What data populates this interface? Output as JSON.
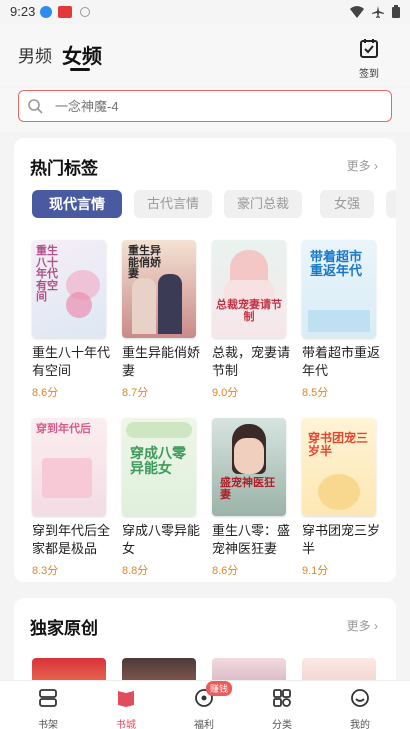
{
  "status": {
    "time": "9:23"
  },
  "header": {
    "tabs": [
      {
        "label": "男频"
      },
      {
        "label": "女频"
      }
    ],
    "signin_label": "签到"
  },
  "search": {
    "placeholder": "一念神魔-4"
  },
  "hot_tags": {
    "title": "热门标签",
    "more": "更多 ›",
    "chips": [
      {
        "label": "现代言情"
      },
      {
        "label": "古代言情"
      },
      {
        "label": "豪门总裁"
      },
      {
        "label": "女强"
      }
    ],
    "books": [
      {
        "title": "重生八十年代有空间",
        "score": "8.6分",
        "cover_text": "重生八十年代有空间"
      },
      {
        "title": "重生异能俏娇妻",
        "score": "8.7分",
        "cover_text": "重生异能俏娇妻"
      },
      {
        "title": "总裁，宠妻请节制",
        "score": "9.0分",
        "cover_text": "总裁宠妻请节制"
      },
      {
        "title": "带着超市重返年代",
        "score": "8.5分",
        "cover_text": "带着超市重返年代"
      },
      {
        "title": "穿到年代后全家都是极品",
        "score": "8.3分",
        "cover_text": "穿到年代后"
      },
      {
        "title": "穿成八零异能女",
        "score": "8.8分",
        "cover_text": "穿成八零异能女"
      },
      {
        "title": "重生八零：盛宠神医狂妻",
        "score": "8.6分",
        "cover_text": "盛宠神医狂妻"
      },
      {
        "title": "穿书团宠三岁半",
        "score": "9.1分",
        "cover_text": "穿书团宠三岁半"
      }
    ]
  },
  "exclusive": {
    "title": "独家原创",
    "more": "更多 ›"
  },
  "nav": {
    "items": [
      {
        "label": "书架"
      },
      {
        "label": "书城"
      },
      {
        "label": "福利",
        "badge": "赚钱"
      },
      {
        "label": "分类"
      },
      {
        "label": "我的"
      }
    ]
  },
  "colors": {
    "accent": "#e24d5e",
    "chip_active": "#4a5aa0",
    "score": "#e0872a",
    "search_border": "#e46a6a"
  }
}
